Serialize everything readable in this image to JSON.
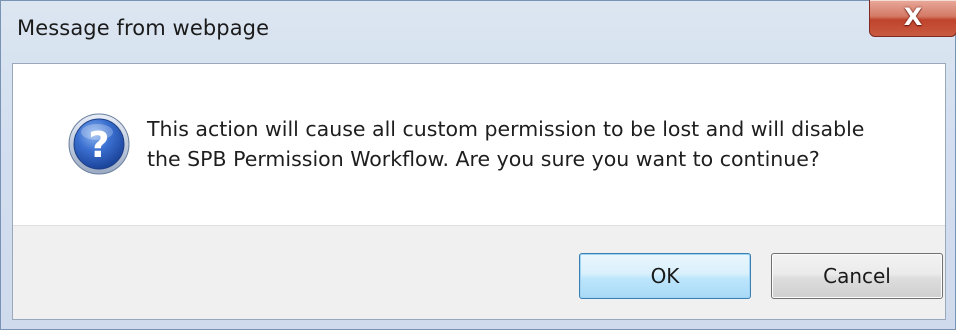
{
  "window": {
    "title": "Message from webpage",
    "close_icon": "close-icon",
    "close_glyph": "X"
  },
  "dialog": {
    "icon": "question-icon",
    "icon_glyph": "?",
    "message_line1": "This action will cause all custom permission to be lost and will disable",
    "message_line2": "the SPB Permission Workflow. Are you sure you want to continue?"
  },
  "buttons": {
    "ok_label": "OK",
    "cancel_label": "Cancel"
  },
  "colors": {
    "ok_border": "#3c7fb1",
    "close_red": "#c0442c",
    "icon_blue": "#1f4fa8"
  }
}
